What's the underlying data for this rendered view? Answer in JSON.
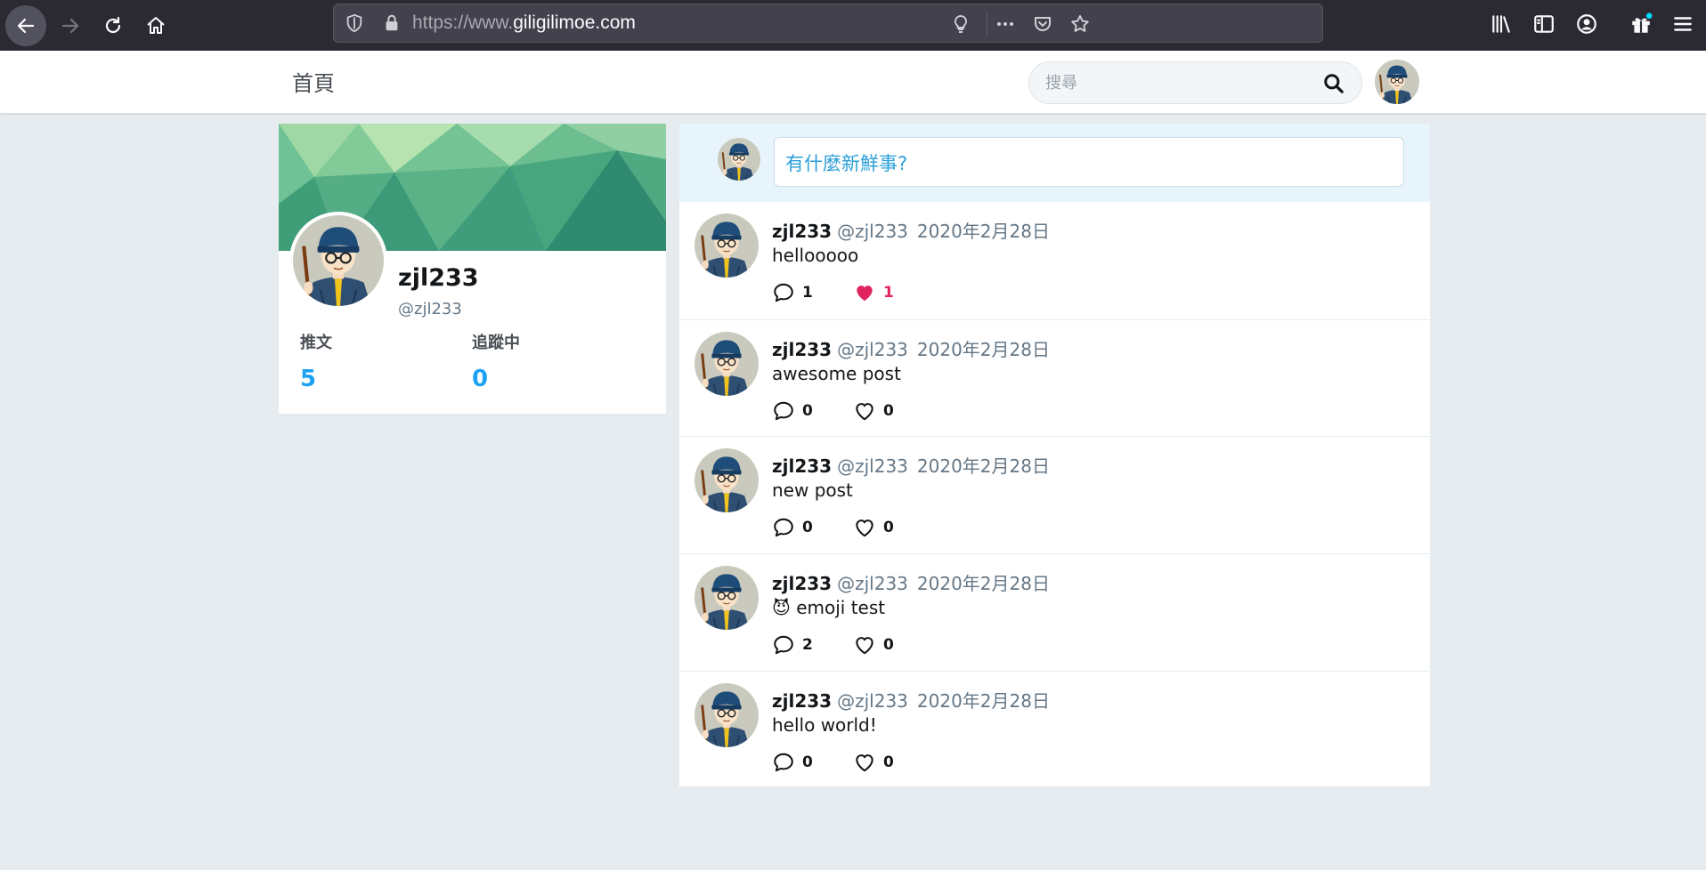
{
  "browser": {
    "url_prefix": "https://www.",
    "url_domain": "giligilimoe.com"
  },
  "header": {
    "home_label": "首頁",
    "search_placeholder": "搜尋"
  },
  "profile": {
    "name": "zjl233",
    "handle": "@zjl233",
    "tweets_label": "推文",
    "tweets_count": "5",
    "following_label": "追蹤中",
    "following_count": "0"
  },
  "compose": {
    "placeholder": "有什麼新鮮事?"
  },
  "tweets": [
    {
      "name": "zjl233",
      "handle": "@zjl233",
      "date": "2020年2月28日",
      "text": "hellooooo",
      "replies": "1",
      "likes": "1",
      "liked": true
    },
    {
      "name": "zjl233",
      "handle": "@zjl233",
      "date": "2020年2月28日",
      "text": "awesome post",
      "replies": "0",
      "likes": "0",
      "liked": false
    },
    {
      "name": "zjl233",
      "handle": "@zjl233",
      "date": "2020年2月28日",
      "text": "new post",
      "replies": "0",
      "likes": "0",
      "liked": false
    },
    {
      "name": "zjl233",
      "handle": "@zjl233",
      "date": "2020年2月28日",
      "text": "😈 emoji test",
      "replies": "2",
      "likes": "0",
      "liked": false
    },
    {
      "name": "zjl233",
      "handle": "@zjl233",
      "date": "2020年2月28日",
      "text": "hello world!",
      "replies": "0",
      "likes": "0",
      "liked": false
    }
  ],
  "colors": {
    "accent": "#1da1f2",
    "like_active": "#e0245e",
    "page_bg": "#e6ebef",
    "chrome_bg": "#2b2a33"
  }
}
